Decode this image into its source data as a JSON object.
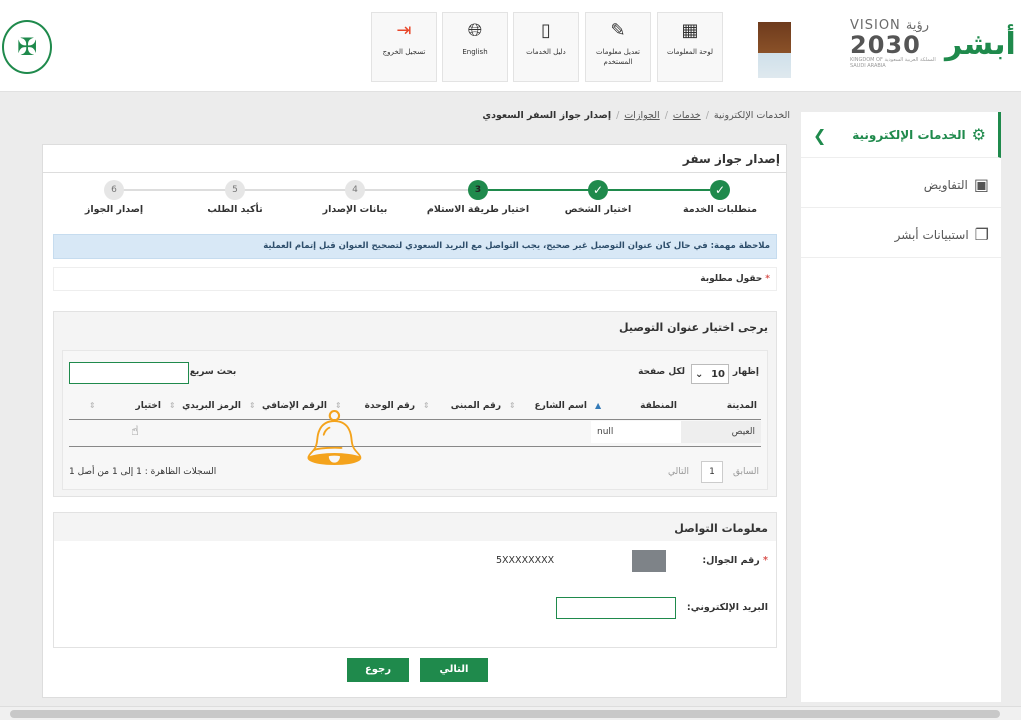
{
  "header": {
    "tiles": [
      {
        "label": "تسجيل الخروج",
        "icon": "logout-icon"
      },
      {
        "label": "English",
        "icon": "globe-icon"
      },
      {
        "label": "دليل الخدمات",
        "icon": "book-icon"
      },
      {
        "label": "تعديل معلومات المستخدم",
        "icon": "edit-icon"
      },
      {
        "label": "لوحة المعلومات",
        "icon": "dashboard-icon"
      }
    ],
    "vision_line1": "VISION رؤية",
    "vision_year": "2030",
    "vision_sub": "المملكة العربية السعودية KINGDOM OF SAUDI ARABIA",
    "logo_text": "أبشر"
  },
  "sidebar": {
    "items": [
      {
        "label": "الخدمات الإلكترونية",
        "icon": "services-icon"
      },
      {
        "label": "التفاويض",
        "icon": "briefcase-icon"
      },
      {
        "label": "استبيانات أبشر",
        "icon": "survey-icon"
      }
    ]
  },
  "breadcrumb": {
    "items": [
      "الخدمات الإلكترونية",
      "خدمات",
      "الجوازات",
      "إصدار جواز السفر السعودي"
    ]
  },
  "page": {
    "title": "إصدار جواز سفر",
    "steps": [
      {
        "num": "1",
        "label": "متطلبات الخدمة",
        "state": "done"
      },
      {
        "num": "2",
        "label": "اختيار الشخص",
        "state": "done"
      },
      {
        "num": "3",
        "label": "اختيار طريقة الاستلام",
        "state": "current"
      },
      {
        "num": "4",
        "label": "بيانات الإصدار",
        "state": "todo"
      },
      {
        "num": "5",
        "label": "تأكيد الطلب",
        "state": "todo"
      },
      {
        "num": "6",
        "label": "إصدار الجواز",
        "state": "todo"
      }
    ],
    "alert": "ملاحظة مهمة: في حال كان عنوان التوصيل غير صحيح، يجب التواصل مع البريد السعودي لتصحيح العنوان قبل إتمام العملية",
    "required_note": "حقول مطلوبة"
  },
  "address": {
    "title": "يرجى اختيار عنوان التوصيل",
    "show_label": "إظهار",
    "page_size": "10",
    "per_page_label": "لكل صفحة",
    "search_label": "بحث سريع :",
    "columns": [
      "المدينة",
      "المنطقة",
      "اسم الشارع",
      "رقم المبنى",
      "رقم الوحدة",
      "الرقم الإضافي",
      "الرمز البريدي",
      "اختيار"
    ],
    "rows": [
      {
        "city": "العيص",
        "region": "null"
      }
    ],
    "prev_label": "السابق",
    "page_num": "1",
    "next_label": "التالي",
    "records_info": "السجلات الظاهرة : 1 إلى 1 من أصل 1"
  },
  "contact": {
    "title": "معلومات التواصل",
    "mobile_label": "رقم الجوال:",
    "mobile_value": "5XXXXXXXX",
    "email_label": "البريد الإلكتروني:",
    "email_value": ""
  },
  "buttons": {
    "next": "التالي",
    "back": "رجوع"
  },
  "colors": {
    "brand_green": "#1f8a4c",
    "alert_bg": "#d8e8f6",
    "bell": "#f4a31c"
  }
}
